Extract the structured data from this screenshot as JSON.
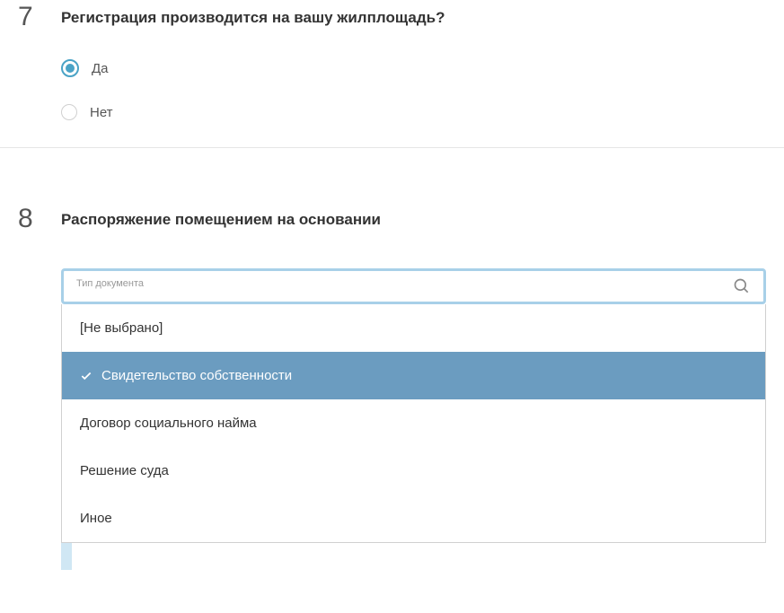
{
  "question7": {
    "number": "7",
    "text": "Регистрация производится на вашу жилплощадь?",
    "options": {
      "yes": "Да",
      "no": "Нет"
    }
  },
  "question8": {
    "number": "8",
    "text": "Распоряжение помещением на основании",
    "selectLabel": "Тип документа",
    "options": {
      "none": "[Не выбрано]",
      "ownership": "Свидетельство собственности",
      "social": "Договор социального найма",
      "court": "Решение суда",
      "other": "Иное"
    }
  }
}
